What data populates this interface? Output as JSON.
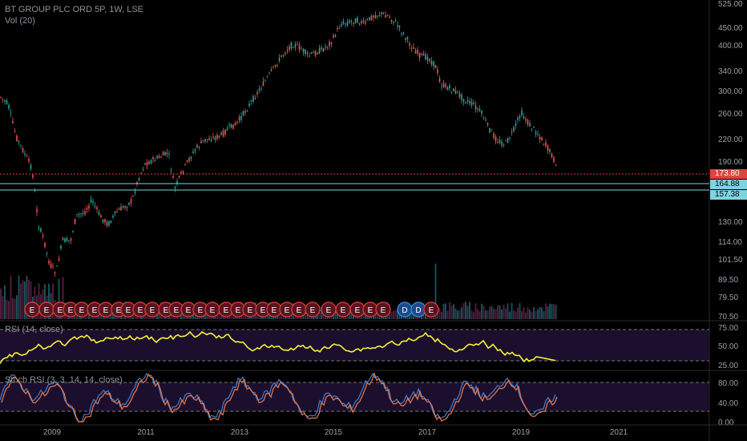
{
  "header": {
    "symbol_line": "BT GROUP PLC ORD 5P, 1W, LSE",
    "volume_label": "Vol (20)",
    "rsi_label": "RSI (14, close)",
    "stoch_label": "Stoch RSI (3, 3, 14, 14, close)"
  },
  "colors": {
    "up": "#26a69a",
    "down": "#ef5350",
    "rsi": "#f5f238",
    "stoch_k": "#3d7fd6",
    "stoch_d": "#ef7a4a",
    "band": "#1c0f2e",
    "current_price": "#e0443a",
    "levels": "#7fd3e0"
  },
  "price_axis": {
    "ticks": [
      "525.00",
      "450.00",
      "400.00",
      "340.00",
      "300.00",
      "260.00",
      "220.00",
      "190.00",
      "164.88",
      "130.00",
      "114.00",
      "101.50",
      "89.50",
      "79.50",
      "70.50"
    ],
    "current_price": "173.80",
    "level_1": "164.88",
    "level_2": "157.38"
  },
  "rsi_axis": {
    "ticks": [
      "75.00",
      "50.00",
      "25.00"
    ]
  },
  "stoch_axis": {
    "ticks": [
      "80.00",
      "40.00",
      "0.00"
    ]
  },
  "time_axis": {
    "ticks": [
      "2009",
      "2011",
      "2013",
      "2015",
      "2017",
      "2019",
      "2021"
    ]
  },
  "events": [
    "E",
    "E",
    "E",
    "E",
    "E",
    "E",
    "E",
    "E",
    "E",
    "E",
    "E",
    "E",
    "E",
    "E",
    "E",
    "E",
    "E",
    "E",
    "E",
    "E",
    "E",
    "E",
    "E",
    "E",
    "E",
    "E",
    "E",
    "E",
    "E",
    "D",
    "D",
    "E"
  ],
  "chart_data": {
    "type": "candlestick",
    "title": "BT GROUP PLC ORD 5P, 1W, LSE",
    "scale": "log",
    "ylim": [
      70.5,
      525
    ],
    "x": [
      "2008",
      "2009",
      "2010",
      "2011",
      "2012",
      "2013",
      "2014",
      "2015",
      "2016",
      "2017",
      "2018",
      "2019"
    ],
    "close": [
      285,
      92,
      130,
      185,
      210,
      330,
      380,
      455,
      470,
      350,
      240,
      173.8
    ],
    "rsi": {
      "overbought": 70,
      "oversold": 30,
      "last": 30
    },
    "stoch_rsi": {
      "upper": 80,
      "lower": 20
    }
  }
}
